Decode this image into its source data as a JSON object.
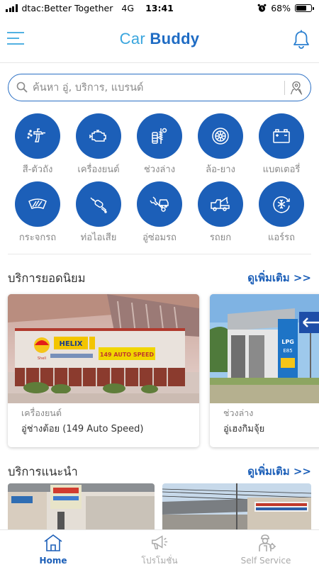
{
  "status_bar": {
    "carrier": "dtac:Better Together",
    "network": "4G",
    "time": "13:41",
    "battery": "68%",
    "battery_level": 0.68
  },
  "header": {
    "title_part1": "Car",
    "title_part2": "Buddy",
    "menu_icon": "hamburger-menu-icon",
    "bell_icon": "bell-icon"
  },
  "search": {
    "placeholder": "ค้นหา อู่, บริการ, แบรนด์"
  },
  "categories": [
    {
      "label": "สี-ตัวถัง",
      "icon": "spray-gun-icon"
    },
    {
      "label": "เครื่องยนต์",
      "icon": "engine-icon"
    },
    {
      "label": "ช่วงล่าง",
      "icon": "suspension-icon"
    },
    {
      "label": "ล้อ-ยาง",
      "icon": "tire-icon"
    },
    {
      "label": "แบตเตอรี่",
      "icon": "battery-icon"
    },
    {
      "label": "กระจกรถ",
      "icon": "windshield-icon"
    },
    {
      "label": "ท่อไอเสีย",
      "icon": "exhaust-pipe-icon"
    },
    {
      "label": "อู่ซ่อมรถ",
      "icon": "repair-shop-icon"
    },
    {
      "label": "รถยก",
      "icon": "tow-truck-icon"
    },
    {
      "label": "แอร์รถ",
      "icon": "air-conditioner-icon"
    }
  ],
  "popular": {
    "title": "บริการยอดนิยม",
    "more": "ดูเพิ่มเติม >>",
    "cards": [
      {
        "category": "เครื่องยนต์",
        "name": "อู่ช่างต้อย (149 Auto Speed)",
        "sign_brand": "Shell",
        "sign_helix": "HELIX",
        "sign_shop": "149 AUTO SPEED"
      },
      {
        "category": "ช่วงล่าง",
        "name": "อู่เฮงกิมจุ้ย",
        "sign_lpg": "LPG",
        "sign_code": "E85"
      }
    ]
  },
  "recommended": {
    "title": "บริการแนะนำ",
    "more": "ดูเพิ่มเติม >>"
  },
  "bottom_nav": [
    {
      "label": "Home",
      "icon": "home-icon",
      "active": true
    },
    {
      "label": "โปรโมชั่น",
      "icon": "megaphone-icon",
      "active": false
    },
    {
      "label": "Self Service",
      "icon": "mechanic-icon",
      "active": false
    }
  ],
  "colors": {
    "primary": "#1c5fb8",
    "accent": "#3aa6de",
    "inactive": "#aaaaaa"
  }
}
